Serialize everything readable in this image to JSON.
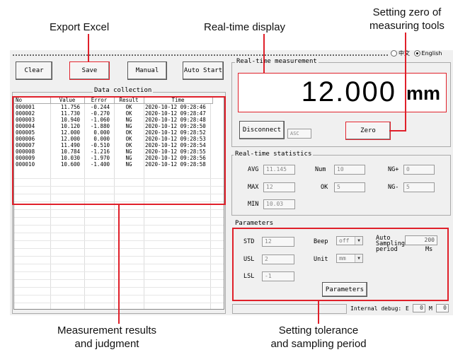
{
  "callouts": {
    "export_excel": "Export Excel",
    "realtime_display": "Real-time display",
    "zero_line1": "Setting zero of",
    "zero_line2": "measuring tools",
    "results_line1": "Measurement results",
    "results_line2": "and judgment",
    "tolerance_line1": "Setting tolerance",
    "tolerance_line2": "and sampling period"
  },
  "language": {
    "zh": "中文",
    "en": "English",
    "selected": "English"
  },
  "toolbar": {
    "clear": "Clear",
    "save": "Save",
    "manual": "Manual",
    "auto_start": "Auto Start"
  },
  "data_collection": {
    "title": "Data collection",
    "columns": [
      "No",
      "Value",
      "Error",
      "Result",
      "Time"
    ],
    "rows": [
      [
        "000001",
        "11.756",
        "-0.244",
        "OK",
        "2020-10-12 09:28:46"
      ],
      [
        "000002",
        "11.730",
        "-0.270",
        "OK",
        "2020-10-12 09:28:47"
      ],
      [
        "000003",
        "10.940",
        "-1.060",
        "NG",
        "2020-10-12 09:28:48"
      ],
      [
        "000004",
        "10.120",
        "-1.880",
        "NG",
        "2020-10-12 09:28:50"
      ],
      [
        "000005",
        "12.000",
        "0.000",
        "OK",
        "2020-10-12 09:28:52"
      ],
      [
        "000006",
        "12.000",
        "0.000",
        "OK",
        "2020-10-12 09:28:53"
      ],
      [
        "000007",
        "11.490",
        "-0.510",
        "OK",
        "2020-10-12 09:28:54"
      ],
      [
        "000008",
        "10.784",
        "-1.216",
        "NG",
        "2020-10-12 09:28:55"
      ],
      [
        "000009",
        "10.030",
        "-1.970",
        "NG",
        "2020-10-12 09:28:56"
      ],
      [
        "000010",
        "10.600",
        "-1.400",
        "NG",
        "2020-10-12 09:28:58"
      ]
    ]
  },
  "realtime": {
    "title": "Real-time measurement",
    "value": "12.000",
    "unit": "mm",
    "disconnect": "Disconnect",
    "mode": "ASC",
    "zero": "Zero"
  },
  "statistics": {
    "title": "Real-time statistics",
    "avg_label": "AVG",
    "avg": "11.145",
    "num_label": "Num",
    "num": "10",
    "ngplus_label": "NG+",
    "ngplus": "0",
    "max_label": "MAX",
    "max": "12",
    "ok_label": "OK",
    "ok": "5",
    "ngminus_label": "NG-",
    "ngminus": "5",
    "min_label": "MIN",
    "min": "10.03"
  },
  "parameters": {
    "title": "Parameters",
    "std_label": "STD",
    "std": "12",
    "usl_label": "USL",
    "usl": "2",
    "lsl_label": "LSL",
    "lsl": "-1",
    "beep_label": "Beep",
    "beep": "off",
    "unit_label": "Unit",
    "unit": "mm",
    "auto_label1": "Auto",
    "auto_label2": "Sampling",
    "auto_label3": "period",
    "auto_value": "200",
    "auto_unit": "Ms",
    "button": "Parameters"
  },
  "debug": {
    "label": "Internal debug:",
    "e_label": "E",
    "e_value": "0",
    "m_label": "M",
    "m_value": "0"
  },
  "colors": {
    "highlight": "#e0202a",
    "window": "#f0f0f0"
  }
}
